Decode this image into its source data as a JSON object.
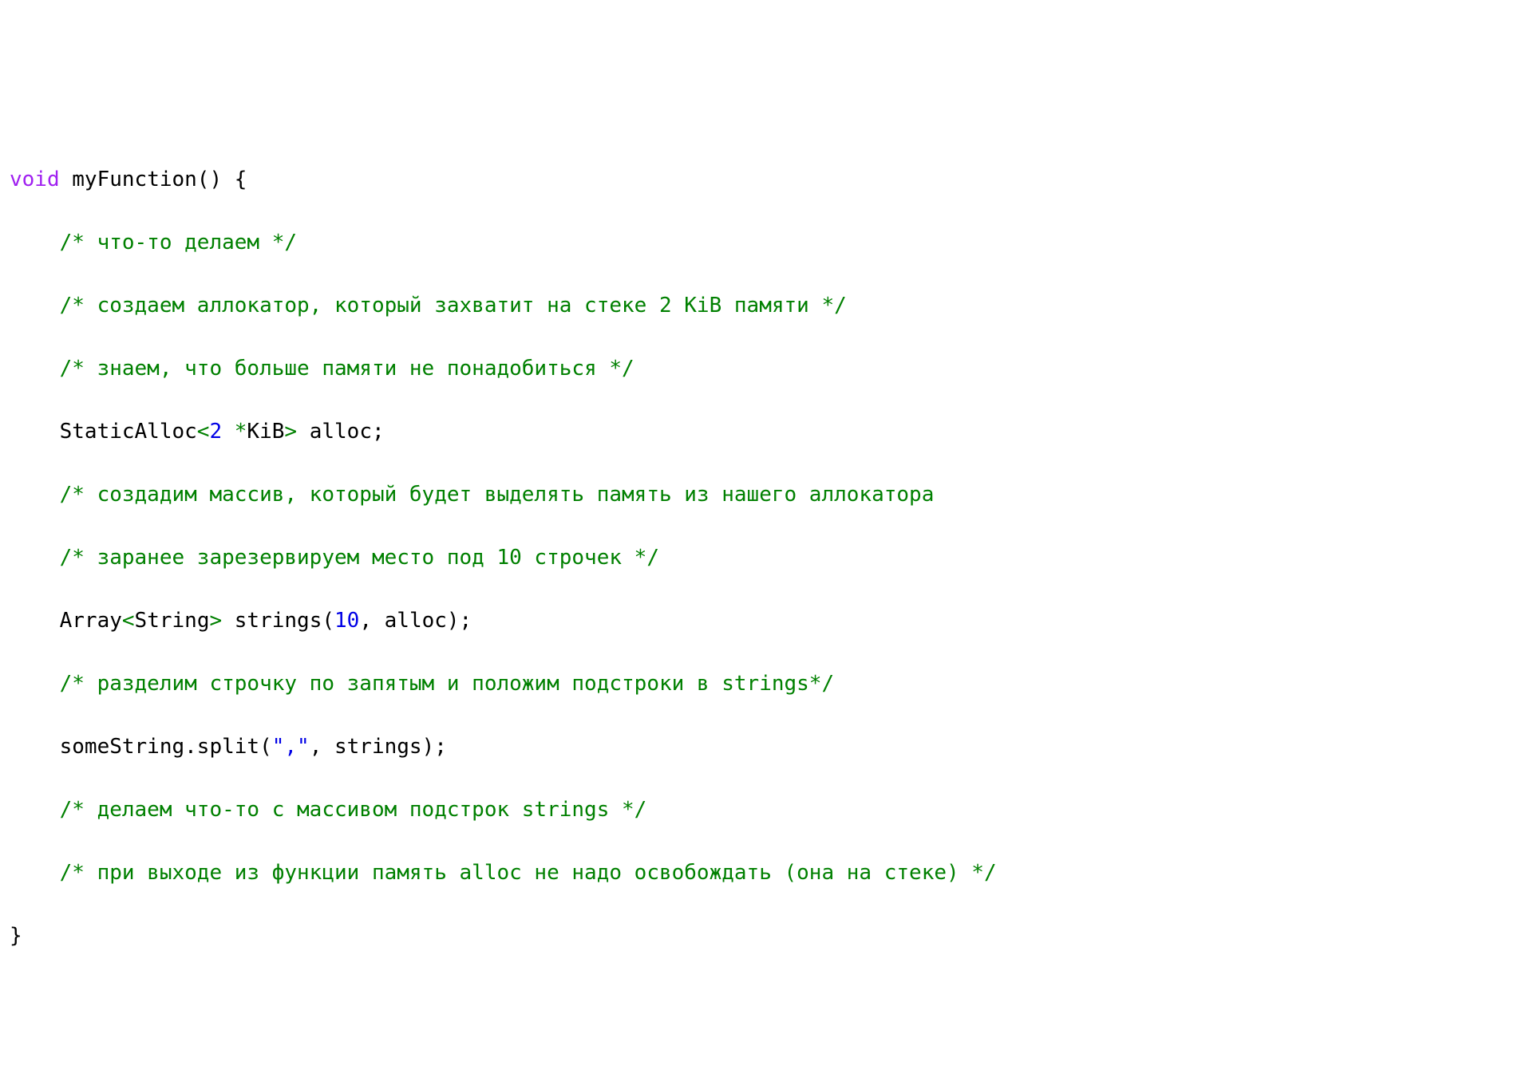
{
  "colors": {
    "keyword": "#a020f0",
    "comment": "#008000",
    "number": "#0000e6",
    "string": "#0000e6",
    "default": "#000000",
    "operator": "#008000"
  },
  "code": {
    "l1": {
      "kw_void": "void",
      "rest": " myFunction() {"
    },
    "l2": "/* что-то делаем */",
    "l3": "/* создаем аллокатор, который захватит на стеке 2 KiB памяти */",
    "l4": "/* знаем, что больше памяти не понадобиться */",
    "l5": {
      "a": "StaticAlloc",
      "lt": "<",
      "num": "2",
      "space": " ",
      "star": "*",
      "kib": "KiB",
      "gt": ">",
      "tail": " alloc;"
    },
    "l6": "/* создадим массив, который будет выделять память из нашего аллокатора",
    "l7": "/* заранее зарезервируем место под 10 строчек */",
    "l8": {
      "a": "Array",
      "lt": "<",
      "str": "String",
      "gt": ">",
      "mid": " strings(",
      "num": "10",
      "tail": ", alloc);"
    },
    "l9": "/* разделим строчку по запятым и положим подстроки в strings*/",
    "l10": {
      "a": "someString.split(",
      "s": "\",\"",
      "b": ", strings);"
    },
    "l11": "/* делаем что-то с массивом подстрок strings */",
    "l12": "/* при выходе из функции память alloc не надо освобождать (она на стеке) */",
    "l13": "}"
  }
}
